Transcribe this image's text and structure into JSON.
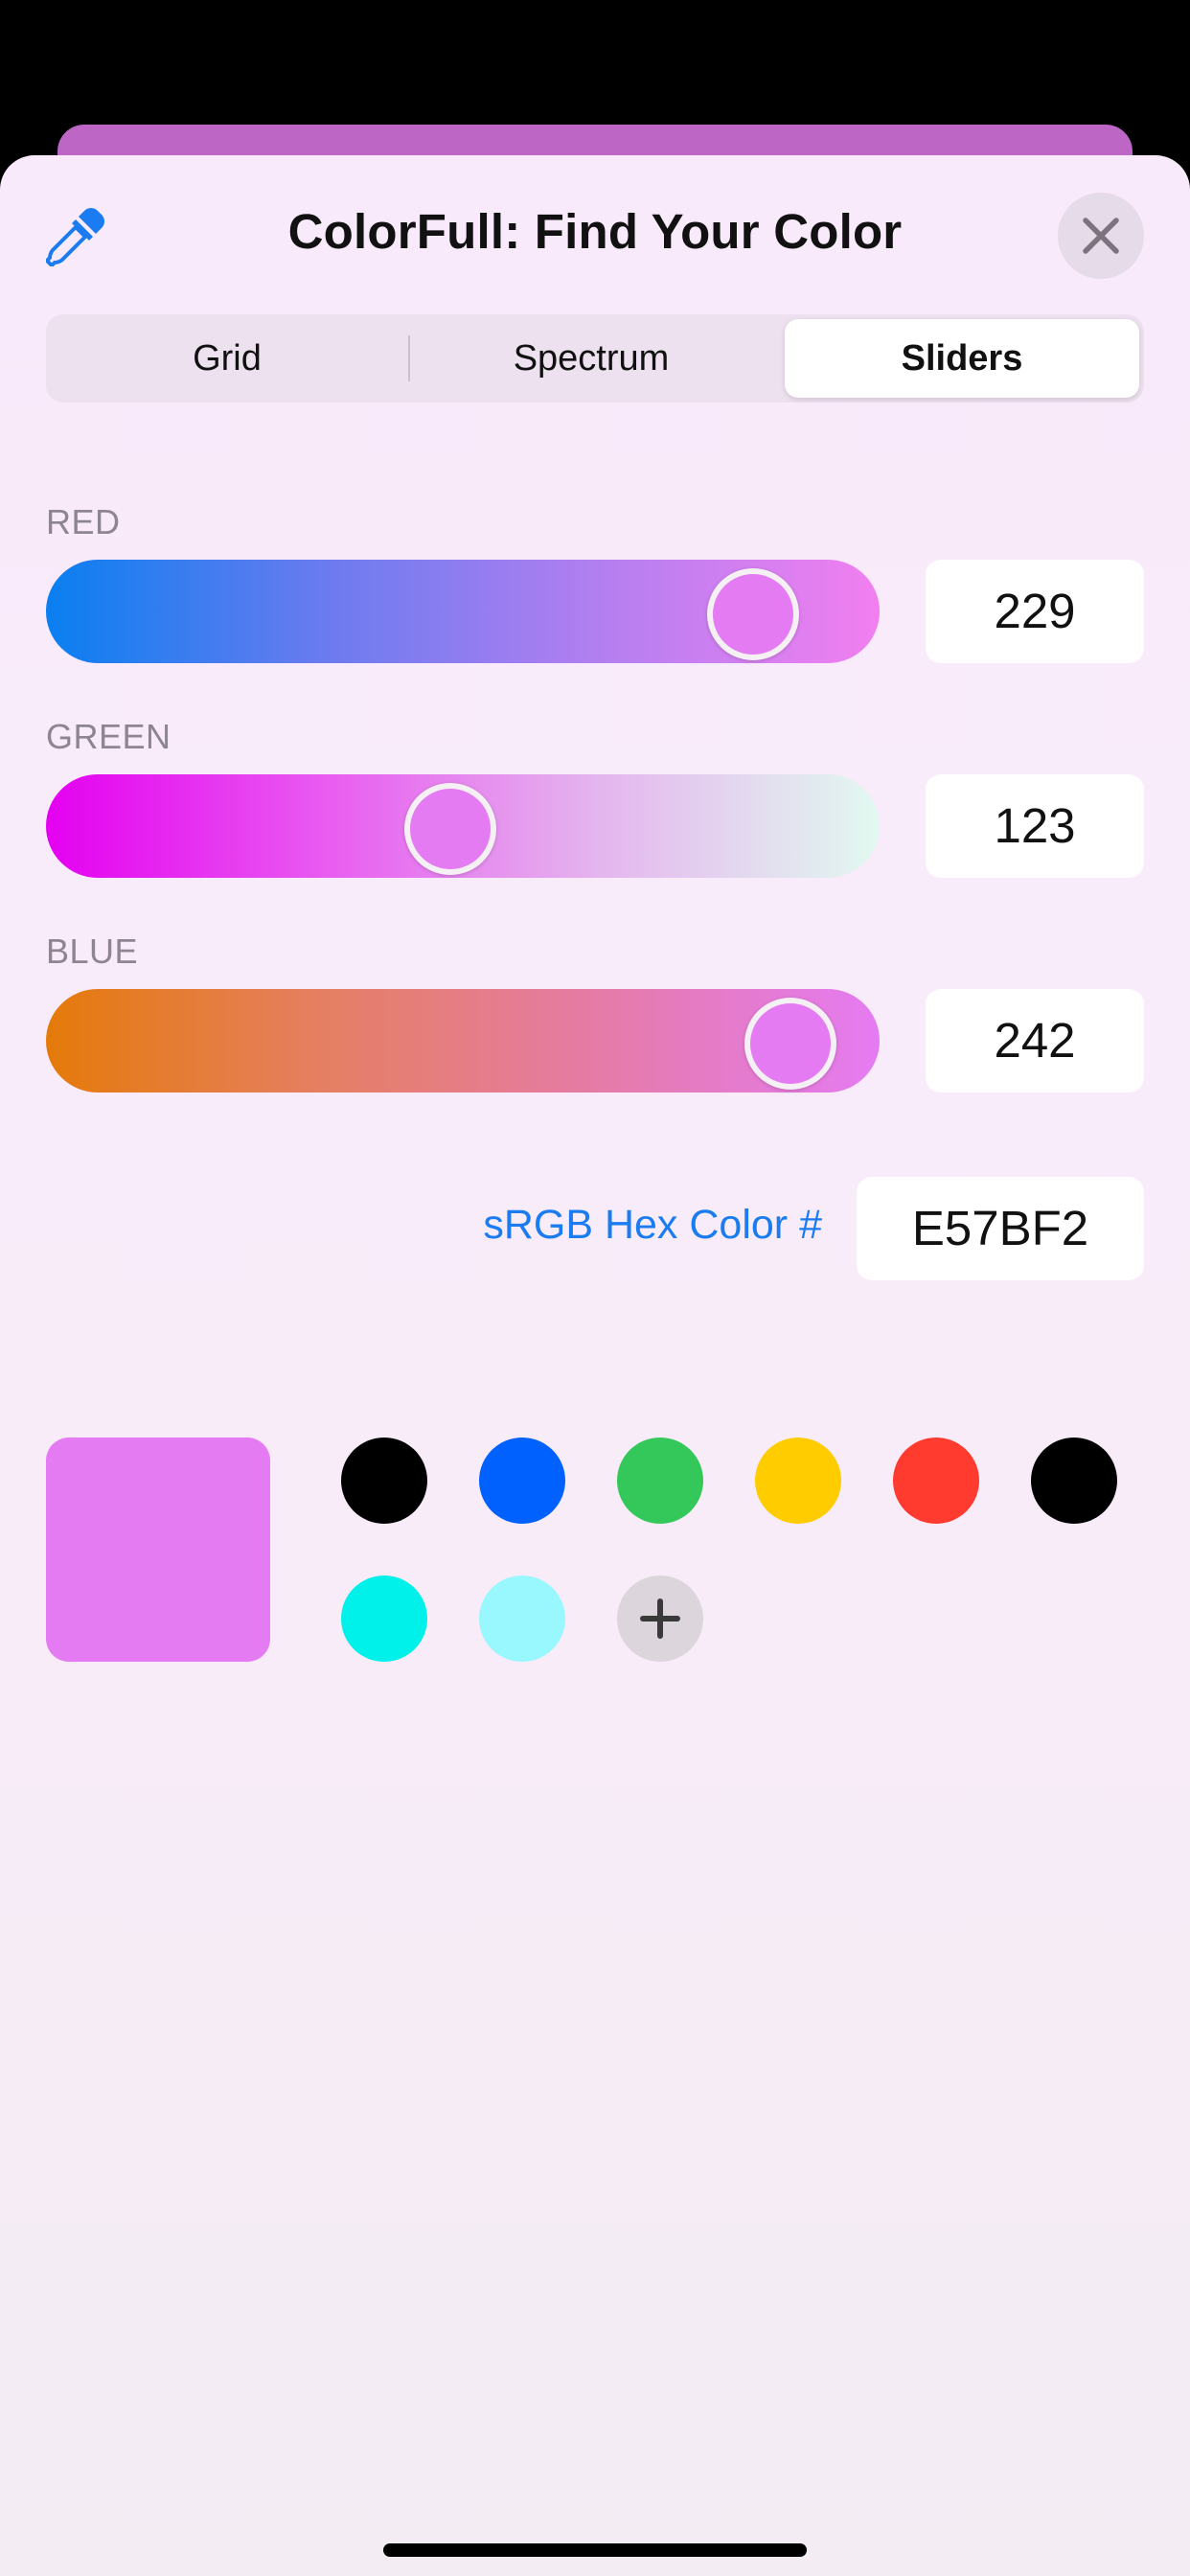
{
  "header": {
    "title": "ColorFull: Find Your Color",
    "eyedropper_icon": "eyedropper-icon",
    "close_icon": "close-icon"
  },
  "tabs": [
    {
      "label": "Grid",
      "selected": false
    },
    {
      "label": "Spectrum",
      "selected": false
    },
    {
      "label": "Sliders",
      "selected": true
    }
  ],
  "sliders": {
    "red": {
      "label": "RED",
      "value": "229",
      "max": 255,
      "gradient": [
        "#0a7ff0",
        "#6a7bef",
        "#b37ff0",
        "#f27ff0"
      ]
    },
    "green": {
      "label": "GREEN",
      "value": "123",
      "max": 255,
      "gradient": [
        "#e400f0",
        "#e85bf0",
        "#e4b6ee",
        "#e2f9f0"
      ]
    },
    "blue": {
      "label": "BLUE",
      "value": "242",
      "max": 255,
      "gradient": [
        "#e57a0a",
        "#e57f63",
        "#e57ba8",
        "#e57bf2"
      ]
    }
  },
  "hex": {
    "label": "sRGB Hex Color #",
    "value": "E57BF2"
  },
  "current_color": "#E57BF2",
  "swatches": [
    "#000000",
    "#0061FE",
    "#34C759",
    "#FFCC00",
    "#FF3B30",
    "#000000",
    "#00F1E9",
    "#99F8FD"
  ],
  "add_swatch_icon": "plus-icon"
}
